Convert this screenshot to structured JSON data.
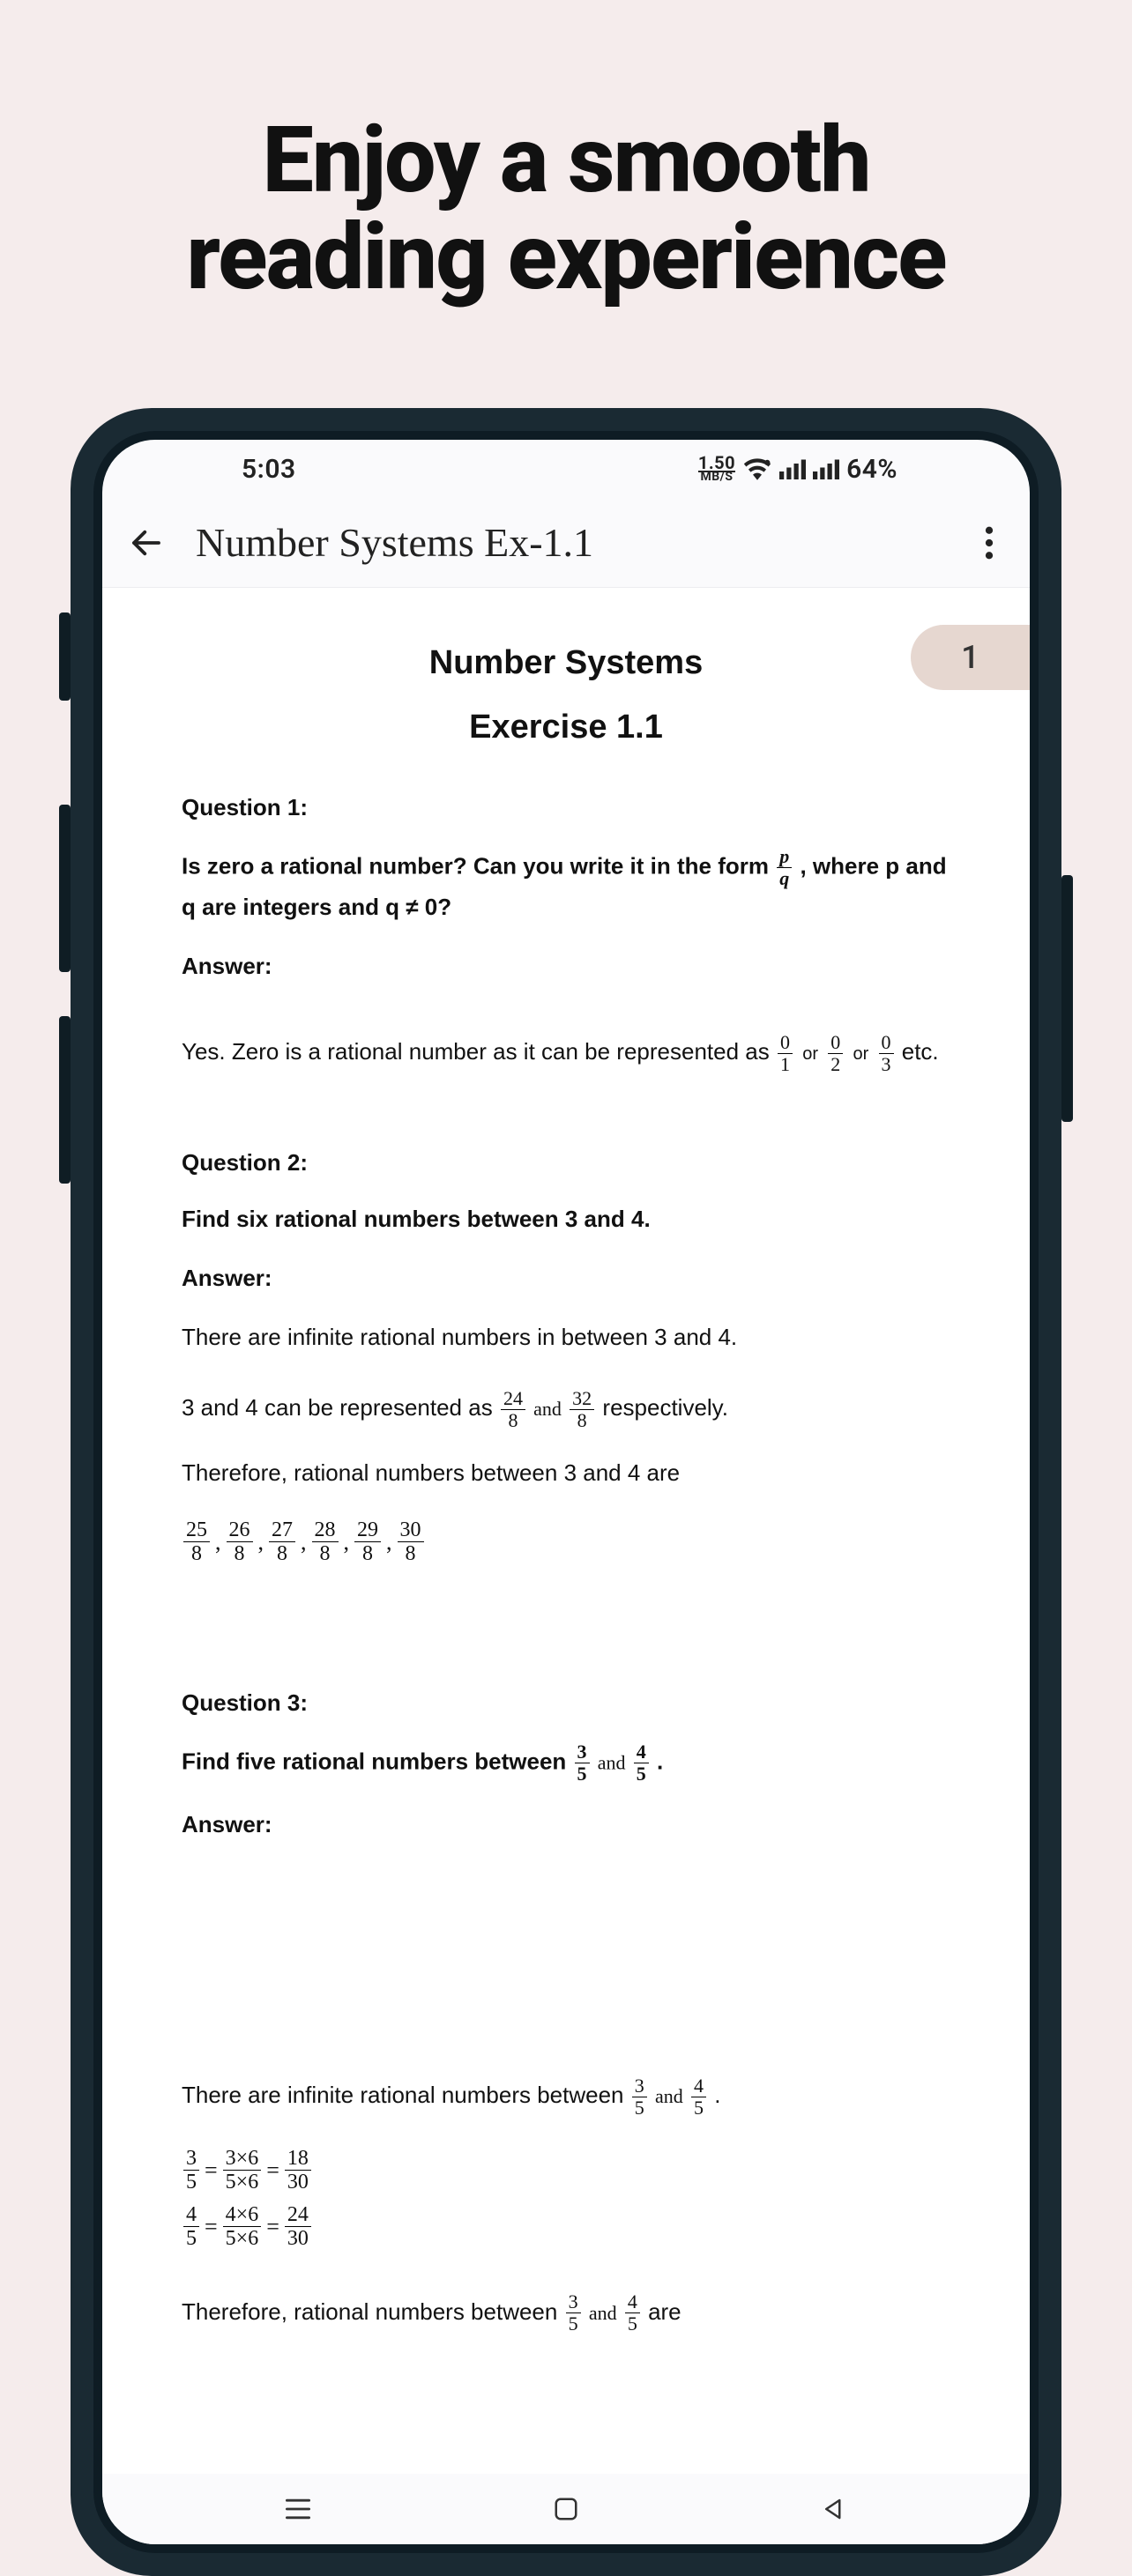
{
  "promo": {
    "line1": "Enjoy a smooth",
    "line2": "reading experience"
  },
  "status": {
    "time": "5:03",
    "mbs_top": "1.50",
    "mbs_bot": "MB/S",
    "battery": "64%"
  },
  "appbar": {
    "title": "Number Systems Ex-1.1"
  },
  "page_number": "1",
  "doc": {
    "title": "Number Systems",
    "subtitle": "Exercise 1.1",
    "q1": {
      "label": "Question 1:",
      "text_a": "Is zero a rational number? Can you write it in the form",
      "text_b": ", where p and q are integers and q ≠ 0?",
      "ans_label": "Answer:",
      "ans_a": "Yes. Zero is a rational number as it can be represented as",
      "ans_b": "etc.",
      "frac_pq_num": "p",
      "frac_pq_den": "q",
      "f01n": "0",
      "f01d": "1",
      "f02n": "0",
      "f02d": "2",
      "f03n": "0",
      "f03d": "3",
      "or": "or"
    },
    "q2": {
      "label": "Question 2:",
      "text": "Find six rational numbers between 3 and 4.",
      "ans_label": "Answer:",
      "ans_a": "There are infinite rational numbers in between 3 and 4.",
      "ans_b_pre": "3 and 4 can be represented as",
      "ans_b_mid": "and",
      "ans_b_post": "respectively.",
      "ans_c": "Therefore, rational numbers between 3 and 4 are",
      "f24n": "24",
      "f24d": "8",
      "f32n": "32",
      "f32d": "8",
      "list": [
        {
          "n": "25",
          "d": "8"
        },
        {
          "n": "26",
          "d": "8"
        },
        {
          "n": "27",
          "d": "8"
        },
        {
          "n": "28",
          "d": "8"
        },
        {
          "n": "29",
          "d": "8"
        },
        {
          "n": "30",
          "d": "8"
        }
      ]
    },
    "q3": {
      "label": "Question 3:",
      "text_pre": "Find five rational numbers between",
      "text_mid": "and",
      "text_post": ".",
      "f35n": "3",
      "f35d": "5",
      "f45n": "4",
      "f45d": "5",
      "ans_label": "Answer:",
      "ans_a_pre": "There are infinite rational numbers between",
      "ans_a_mid": "and",
      "ans_a_post": ".",
      "eq1_l_n": "3",
      "eq1_l_d": "5",
      "eq1_m_n": "3×6",
      "eq1_m_d": "5×6",
      "eq1_r_n": "18",
      "eq1_r_d": "30",
      "eq2_l_n": "4",
      "eq2_l_d": "5",
      "eq2_m_n": "4×6",
      "eq2_m_d": "5×6",
      "eq2_r_n": "24",
      "eq2_r_d": "30",
      "eq_sign": "=",
      "ans_b_pre": "Therefore, rational numbers between",
      "ans_b_mid": "and",
      "ans_b_post": "are"
    }
  }
}
